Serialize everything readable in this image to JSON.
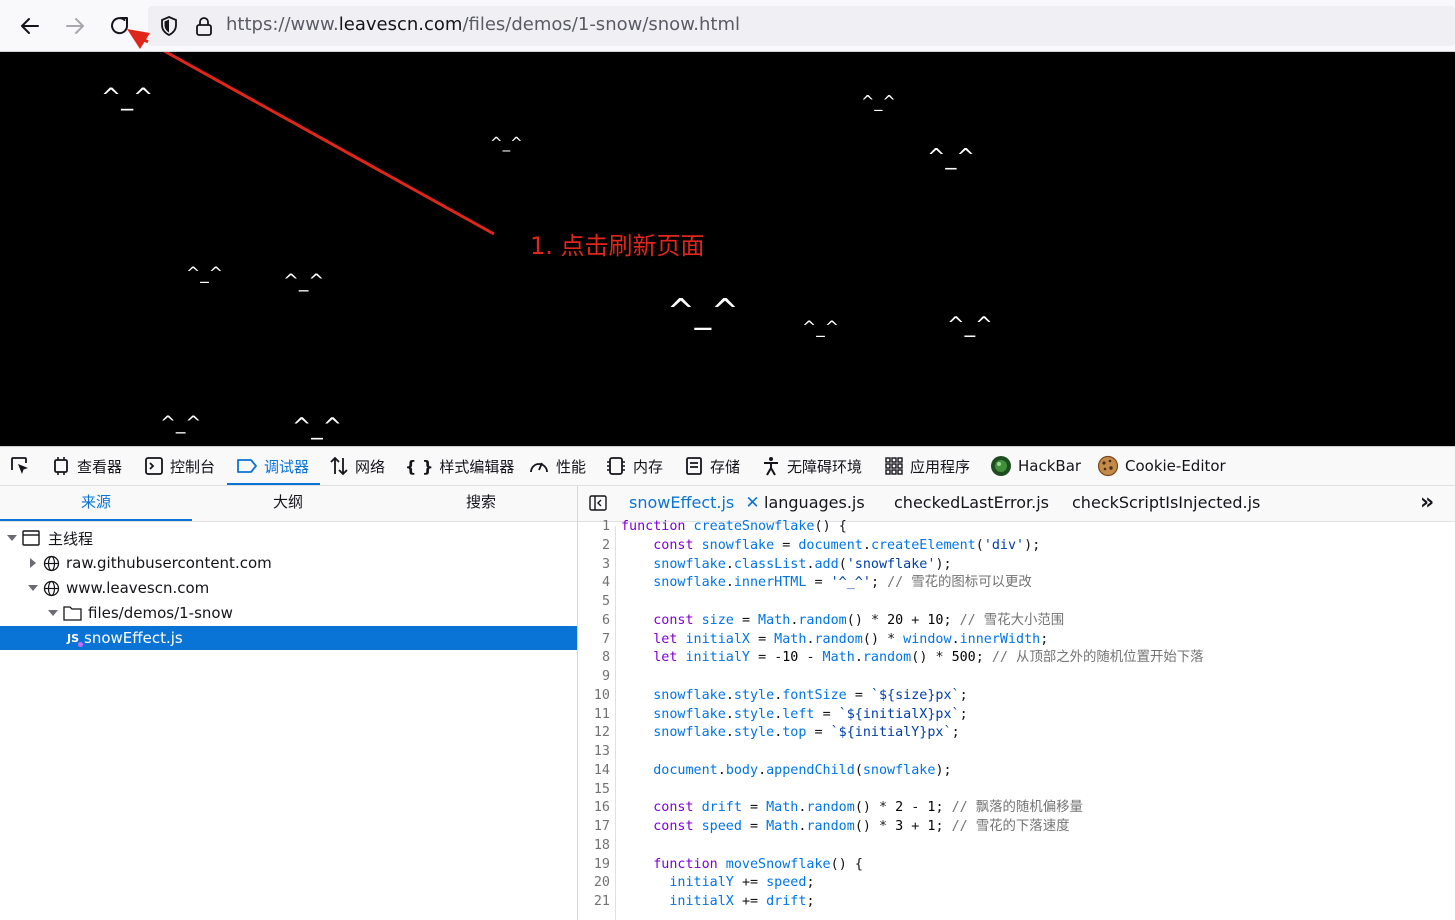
{
  "browser": {
    "url_prefix": "https://www.",
    "url_domain": "leavescn.com",
    "url_path": "/files/demos/1-snow/snow.html"
  },
  "page": {
    "flake_text": "^_^",
    "annotation": "1. 点击刷新页面",
    "annotation_color": "#e0261b"
  },
  "devtools": {
    "tabs": [
      {
        "label": "查看器",
        "icon": "inspector-icon"
      },
      {
        "label": "控制台",
        "icon": "console-icon"
      },
      {
        "label": "调试器",
        "icon": "debugger-icon"
      },
      {
        "label": "网络",
        "icon": "network-icon"
      },
      {
        "label": "样式编辑器",
        "icon": "style-editor-icon"
      },
      {
        "label": "性能",
        "icon": "performance-icon"
      },
      {
        "label": "内存",
        "icon": "memory-icon"
      },
      {
        "label": "存储",
        "icon": "storage-icon"
      },
      {
        "label": "无障碍环境",
        "icon": "accessibility-icon"
      },
      {
        "label": "应用程序",
        "icon": "application-icon"
      },
      {
        "label": "HackBar",
        "icon": "hackbar-icon"
      },
      {
        "label": "Cookie-Editor",
        "icon": "cookie-icon"
      }
    ],
    "active_tab": "调试器",
    "accent_color": "#0a74d6"
  },
  "sources": {
    "tabs": [
      "来源",
      "大纲",
      "搜索"
    ],
    "tree": [
      {
        "label": "主线程",
        "icon": "window-icon"
      },
      {
        "label": "raw.githubusercontent.com",
        "icon": "globe-icon"
      },
      {
        "label": "www.leavescn.com",
        "icon": "globe-icon"
      },
      {
        "label": "files/demos/1-snow",
        "icon": "folder-icon"
      },
      {
        "label": "snowEffect.js",
        "icon": "js-file-icon"
      }
    ]
  },
  "editor": {
    "tabs": [
      "snowEffect.js",
      "languages.js",
      "checkedLastError.js",
      "checkScriptIsInjected.js"
    ],
    "lines": [
      "function createSnowflake() {",
      "    const snowflake = document.createElement('div');",
      "    snowflake.classList.add('snowflake');",
      "    snowflake.innerHTML = '^_^'; // 雪花的图标可以更改",
      "",
      "    const size = Math.random() * 20 + 10; // 雪花大小范围",
      "    let initialX = Math.random() * window.innerWidth;",
      "    let initialY = -10 - Math.random() * 500; // 从顶部之外的随机位置开始下落",
      "",
      "    snowflake.style.fontSize = `${size}px`;",
      "    snowflake.style.left = `${initialX}px`;",
      "    snowflake.style.top = `${initialY}px`;",
      "",
      "    document.body.appendChild(snowflake);",
      "",
      "    const drift = Math.random() * 2 - 1; // 飘落的随机偏移量",
      "    const speed = Math.random() * 3 + 1; // 雪花的下落速度",
      "",
      "    function moveSnowflake() {",
      "      initialY += speed;",
      "      initialX += drift;"
    ]
  }
}
